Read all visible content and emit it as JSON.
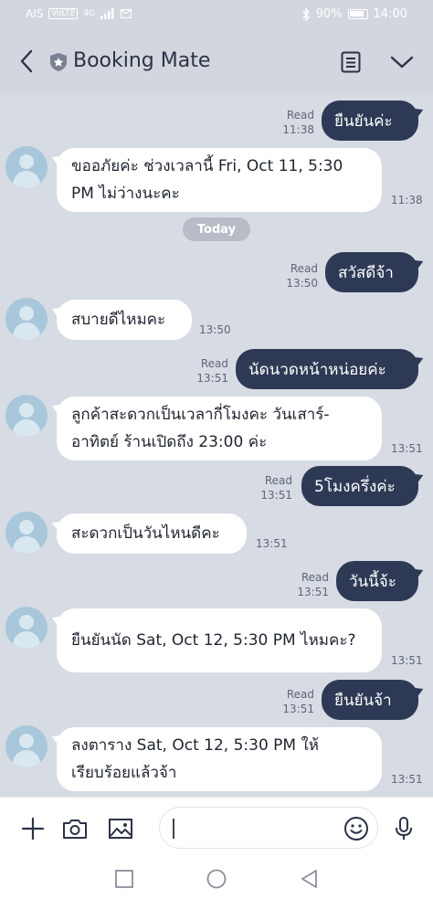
{
  "status_bar": {
    "carrier": "AIS",
    "volte": "VoLTE",
    "network": "4G",
    "battery": "90%",
    "time": "14:00"
  },
  "header": {
    "title": "Booking Mate"
  },
  "messages": [
    {
      "side": "out",
      "text": "ยืนยันค่ะ",
      "read": "Read",
      "time": "11:38"
    },
    {
      "side": "in",
      "text": "ขออภัยค่ะ ช่วงเวลานี้ Fri, Oct 11, 5:30 PM ไม่ว่างนะคะ",
      "time": "11:38"
    },
    {
      "side": "out",
      "text": "สวัสดีจ้า",
      "read": "Read",
      "time": "13:50"
    },
    {
      "side": "in",
      "text": "สบายดีไหมคะ",
      "time": "13:50"
    },
    {
      "side": "out",
      "text": "นัดนวดหน้าหน่อยค่ะ",
      "read": "Read",
      "time": "13:51"
    },
    {
      "side": "in",
      "text": "ลูกค้าสะดวกเป็นเวลากี่โมงคะ วันเสาร์-อาทิตย์ ร้านเปิดถึง 23:00 ค่ะ",
      "time": "13:51"
    },
    {
      "side": "out",
      "text": "5โมงครึ่งค่ะ",
      "read": "Read",
      "time": "13:51"
    },
    {
      "side": "in",
      "text": "สะดวกเป็นวันไหนดีคะ",
      "time": "13:51"
    },
    {
      "side": "out",
      "text": "วันนี้จ้ะ",
      "read": "Read",
      "time": "13:51"
    },
    {
      "side": "in",
      "text": "ยืนยันนัด Sat, Oct 12, 5:30 PM ไหมคะ?",
      "time": "13:51"
    },
    {
      "side": "out",
      "text": "ยืนยันจ้า",
      "read": "Read",
      "time": "13:51"
    },
    {
      "side": "in",
      "text": "ลงตาราง Sat, Oct 12, 5:30 PM ให้เรียบร้อยแล้วจ้า",
      "time": "13:51"
    }
  ],
  "date_divider": "Today",
  "input": {
    "placeholder": ""
  },
  "icons": {
    "back": "chevron-left-icon",
    "shield": "official-shield-icon",
    "note": "notes-icon",
    "menu": "chevron-down-icon",
    "plus": "plus-icon",
    "camera": "camera-icon",
    "image": "image-icon",
    "emoji": "emoji-icon",
    "mic": "microphone-icon"
  },
  "colors": {
    "outgoing_bubble": "#2e3a55",
    "incoming_bubble": "#ffffff",
    "background": "#d7dbe4"
  }
}
